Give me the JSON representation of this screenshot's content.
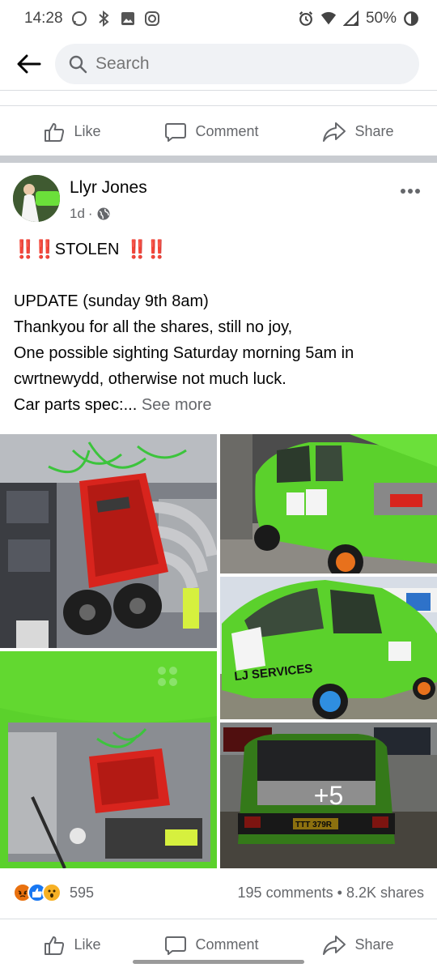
{
  "status_bar": {
    "time": "14:28",
    "battery": "50%"
  },
  "search": {
    "placeholder": "Search"
  },
  "actions": {
    "like": "Like",
    "comment": "Comment",
    "share": "Share"
  },
  "post": {
    "author": "Llyr Jones",
    "time": "1d",
    "separator": "·",
    "stolen_label": "STOLEN",
    "stolen_bangs": "‼️‼️",
    "lines": [
      "UPDATE (sunday 9th 8am)",
      "Thankyou for all the shares, still no joy,",
      "One possible sighting Saturday morning 5am in",
      "cwrtnewydd, otherwise not much luck."
    ],
    "last_line_prefix": "Car parts spec:...",
    "see_more": "See more",
    "extra_photos": "+5",
    "plate": "TTT 379R",
    "livery_text": "LJ SERVICES"
  },
  "engagement": {
    "reaction_count": "595",
    "comments": "195 comments",
    "dot": "•",
    "shares": "8.2K shares",
    "reaction_icons": [
      "angry",
      "like",
      "wow"
    ]
  },
  "colors": {
    "accent": "#1877f2",
    "car_green": "#5bd12c",
    "engine_red": "#d8241d",
    "warning_red": "#e41e3f"
  }
}
